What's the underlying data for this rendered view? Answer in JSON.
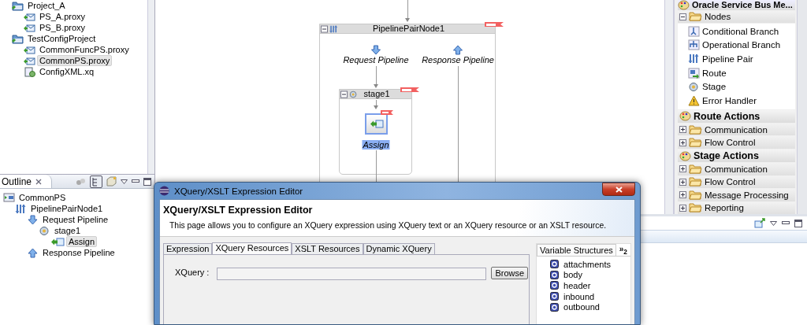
{
  "project_tree": {
    "items": [
      {
        "label": "Project_A",
        "kind": "project",
        "selected": false,
        "children": [
          {
            "label": "PS_A.proxy",
            "kind": "proxy",
            "selected": false
          },
          {
            "label": "PS_B.proxy",
            "kind": "proxy",
            "selected": false
          }
        ]
      },
      {
        "label": "TestConfigProject",
        "kind": "project",
        "selected": false,
        "children": [
          {
            "label": "CommonFuncPS.proxy",
            "kind": "proxy",
            "selected": false
          },
          {
            "label": "CommonPS.proxy",
            "kind": "proxy",
            "selected": true
          },
          {
            "label": "ConfigXML.xq",
            "kind": "xquery",
            "selected": false
          }
        ]
      }
    ]
  },
  "outline": {
    "tab": "Outline",
    "items": [
      {
        "label": "CommonPS",
        "kind": "service",
        "selected": false,
        "children": [
          {
            "label": "PipelinePairNode1",
            "kind": "pipeline-pair",
            "selected": false,
            "children": [
              {
                "label": "Request Pipeline",
                "kind": "request",
                "selected": false,
                "children": [
                  {
                    "label": "stage1",
                    "kind": "stage",
                    "selected": false,
                    "children": [
                      {
                        "label": "Assign",
                        "kind": "action",
                        "selected": true
                      }
                    ]
                  }
                ]
              },
              {
                "label": "Response Pipeline",
                "kind": "response",
                "selected": false
              }
            ]
          }
        ]
      }
    ]
  },
  "canvas": {
    "pipeline_pair": {
      "title": "PipelinePairNode1",
      "request": "Request Pipeline",
      "response": "Response Pipeline",
      "stage": {
        "title": "stage1",
        "action": {
          "label": "Assign",
          "selected": true
        }
      }
    }
  },
  "palette": {
    "title": "Oracle Service Bus Me...",
    "sections": [
      {
        "kind": "drawer",
        "label": "Nodes",
        "expanded": true,
        "items": [
          {
            "label": "Conditional Branch",
            "kind": "conditional-branch"
          },
          {
            "label": "Operational Branch",
            "kind": "operational-branch"
          },
          {
            "label": "Pipeline Pair",
            "kind": "pipeline-pair"
          },
          {
            "label": "Route",
            "kind": "route"
          },
          {
            "label": "Stage",
            "kind": "stage"
          },
          {
            "label": "Error Handler",
            "kind": "error-handler"
          }
        ]
      },
      {
        "kind": "category",
        "label": "Route Actions"
      },
      {
        "kind": "drawer",
        "label": "Communication",
        "expanded": false
      },
      {
        "kind": "drawer",
        "label": "Flow Control",
        "expanded": false
      },
      {
        "kind": "category",
        "label": "Stage Actions"
      },
      {
        "kind": "drawer",
        "label": "Communication",
        "expanded": false
      },
      {
        "kind": "drawer",
        "label": "Flow Control",
        "expanded": false
      },
      {
        "kind": "drawer",
        "label": "Message Processing",
        "expanded": false
      },
      {
        "kind": "drawer",
        "label": "Reporting",
        "expanded": false
      }
    ]
  },
  "dialog": {
    "title": "XQuery/XSLT Expression Editor",
    "heading": "XQuery/XSLT Expression Editor",
    "description": "This page allows you to configure an XQuery expression using XQuery text or an XQuery resource or an XSLT resource.",
    "tabs": [
      {
        "label": "Expression",
        "selected": false
      },
      {
        "label": "XQuery Resources",
        "selected": true
      },
      {
        "label": "XSLT Resources",
        "selected": false
      },
      {
        "label": "Dynamic XQuery",
        "selected": false
      }
    ],
    "xquery_field": {
      "label": "XQuery :"
    },
    "browse_button": "Browse",
    "variables": {
      "tab": "Variable Structures",
      "overflow": "»$_{2}$",
      "items": [
        "attachments",
        "body",
        "header",
        "inbound",
        "outbound"
      ]
    }
  }
}
